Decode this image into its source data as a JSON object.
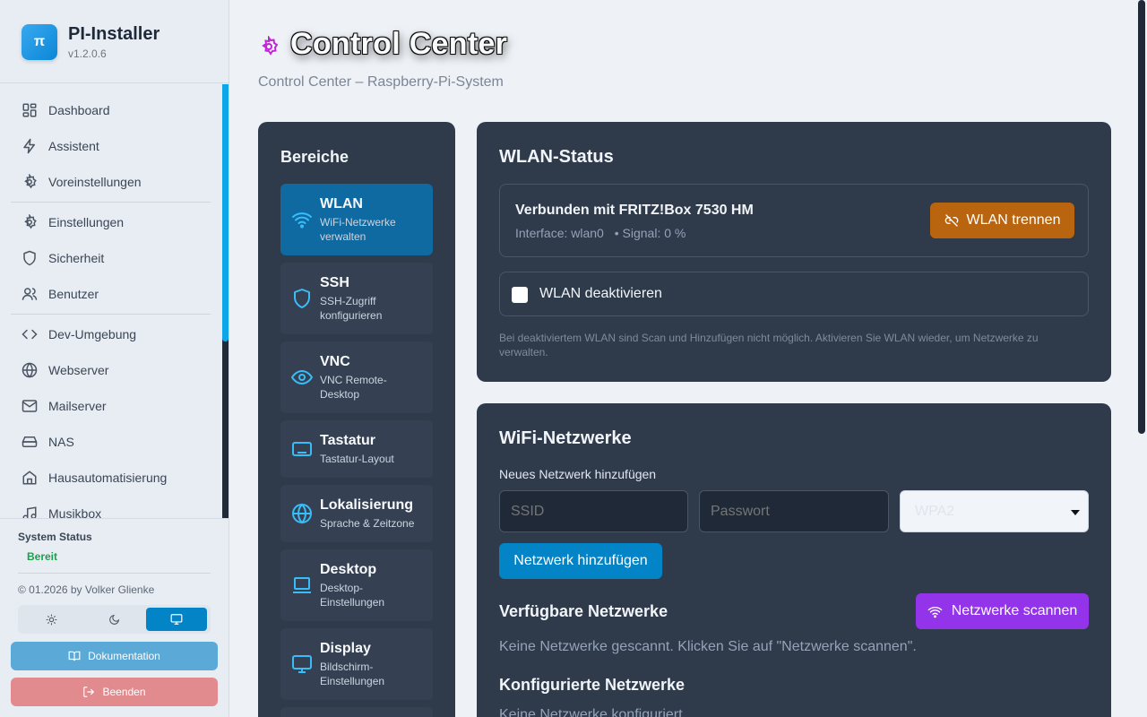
{
  "app": {
    "name": "PI-Installer",
    "version": "v1.2.0.6",
    "logo_glyph": "π"
  },
  "sidebar": {
    "items": [
      {
        "label": "Dashboard",
        "icon": "dashboard-icon"
      },
      {
        "label": "Assistent",
        "icon": "lightning-icon"
      },
      {
        "label": "Voreinstellungen",
        "icon": "gear-icon"
      },
      {
        "label": "Einstellungen",
        "icon": "gear-icon"
      },
      {
        "label": "Sicherheit",
        "icon": "shield-icon"
      },
      {
        "label": "Benutzer",
        "icon": "users-icon"
      },
      {
        "label": "Dev-Umgebung",
        "icon": "code-icon"
      },
      {
        "label": "Webserver",
        "icon": "globe-icon"
      },
      {
        "label": "Mailserver",
        "icon": "mail-icon"
      },
      {
        "label": "NAS",
        "icon": "hard-drive-icon"
      },
      {
        "label": "Hausautomatisierung",
        "icon": "home-icon"
      },
      {
        "label": "Musikbox",
        "icon": "music-icon"
      }
    ],
    "system_status_title": "System Status",
    "system_status_value": "Bereit",
    "copyright": "© 01.2026 by Volker Glienke",
    "theme_options": [
      "light",
      "dark",
      "system"
    ],
    "theme_selected": "system",
    "docs_label": "Dokumentation",
    "quit_label": "Beenden"
  },
  "page": {
    "title": "Control Center",
    "subtitle": "Control Center – Raspberry-Pi-System"
  },
  "areas": {
    "title": "Bereiche",
    "items": [
      {
        "title": "WLAN",
        "desc": "WiFi-Netzwerke verwalten",
        "icon": "wifi-icon",
        "active": true
      },
      {
        "title": "SSH",
        "desc": "SSH-Zugriff konfigurieren",
        "icon": "shield-icon",
        "active": false
      },
      {
        "title": "VNC",
        "desc": "VNC Remote-Desktop",
        "icon": "eye-icon",
        "active": false
      },
      {
        "title": "Tastatur",
        "desc": "Tastatur-Layout",
        "icon": "keyboard-icon",
        "active": false
      },
      {
        "title": "Lokalisierung",
        "desc": "Sprache & Zeitzone",
        "icon": "globe-icon",
        "active": false
      },
      {
        "title": "Desktop",
        "desc": "Desktop-Einstellungen",
        "icon": "laptop-icon",
        "active": false
      },
      {
        "title": "Display",
        "desc": "Bildschirm-Einstellungen",
        "icon": "monitor-icon",
        "active": false
      }
    ]
  },
  "wlan_status": {
    "title": "WLAN-Status",
    "connected_text": "Verbunden mit FRITZ!Box 7530 HM",
    "interface_text": "Interface: wlan0",
    "signal_text": "• Signal: 0 %",
    "disconnect_label": "WLAN trennen",
    "disable_label": "WLAN deaktivieren",
    "disable_checked": false,
    "hint": "Bei deaktiviertem WLAN sind Scan und Hinzufügen nicht möglich. Aktivieren Sie WLAN wieder, um Netzwerke zu verwalten."
  },
  "wifi": {
    "title": "WiFi-Netzwerke",
    "add_label": "Neues Netzwerk hinzufügen",
    "ssid_placeholder": "SSID",
    "password_placeholder": "Passwort",
    "security_selected": "WPA2",
    "add_button": "Netzwerk hinzufügen",
    "available_title": "Verfügbare Netzwerke",
    "scan_button": "Netzwerke scannen",
    "available_empty": "Keine Netzwerke gescannt. Klicken Sie auf \"Netzwerke scannen\".",
    "configured_title": "Konfigurierte Netzwerke",
    "configured_empty": "Keine Netzwerke konfiguriert"
  },
  "colors": {
    "accent": "#0284c7",
    "active_area": "#0e6aa1",
    "warning_button": "#b9640f",
    "scan_button": "#9333ea",
    "status_ok": "#16a34a",
    "title_icon": "#c026d3"
  }
}
